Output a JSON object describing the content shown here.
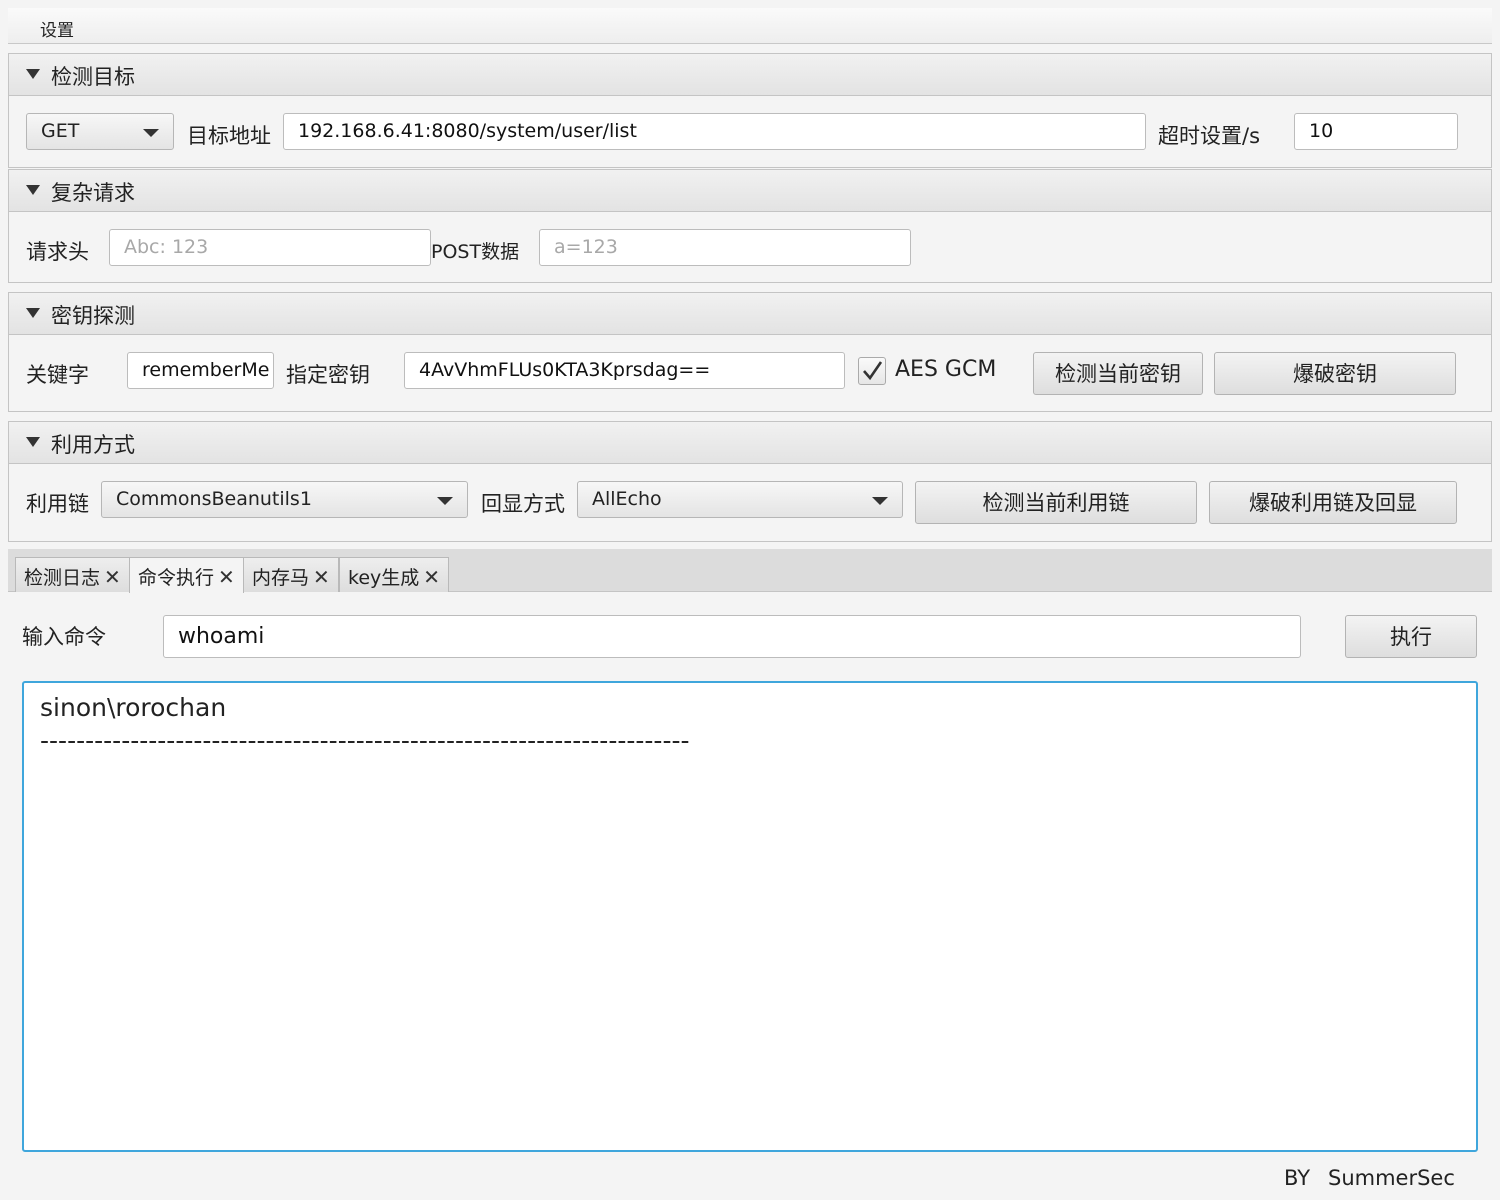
{
  "menubar": {
    "settings": "设置"
  },
  "target": {
    "title": "检测目标",
    "method": "GET",
    "url_label": "目标地址",
    "url": "192.168.6.41:8080/system/user/list",
    "timeout_label": "超时设置/s",
    "timeout": "10"
  },
  "complex": {
    "title": "复杂请求",
    "header_label": "请求头",
    "header_placeholder": "Abc: 123",
    "post_label": "POST数据",
    "post_placeholder": "a=123"
  },
  "key": {
    "title": "密钥探测",
    "keyword_label": "关键字",
    "keyword": "rememberMe",
    "key_label": "指定密钥",
    "key_value": "4AvVhmFLUs0KTA3Kprsdag==",
    "aes_gcm_label": "AES GCM",
    "aes_gcm_checked": true,
    "check_key_btn": "检测当前密钥",
    "brute_key_btn": "爆破密钥"
  },
  "exploit": {
    "title": "利用方式",
    "chain_label": "利用链",
    "chain": "CommonsBeanutils1",
    "echo_label": "回显方式",
    "echo": "AllEcho",
    "check_chain_btn": "检测当前利用链",
    "brute_chain_btn": "爆破利用链及回显"
  },
  "tabs": [
    {
      "label": "检测日志",
      "close": "✕"
    },
    {
      "label": "命令执行",
      "close": "✕"
    },
    {
      "label": "内存马",
      "close": "✕"
    },
    {
      "label": "key生成",
      "close": "✕"
    }
  ],
  "command": {
    "label": "输入命令",
    "value": "whoami",
    "run_btn": "执行",
    "output": "sinon\\rorochan\n------------------------------------------------------------------------"
  },
  "footer": {
    "by": "BY",
    "author": "SummerSec"
  }
}
